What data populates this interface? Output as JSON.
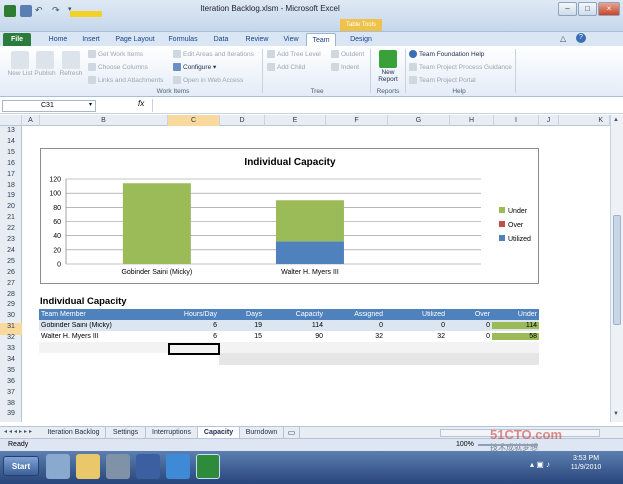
{
  "window": {
    "title": "Iteration Backlog.xlsm - Microsoft Excel",
    "context_label": "Table Tools",
    "controls": [
      "–",
      "□",
      "×"
    ]
  },
  "tabs": [
    "File",
    "Home",
    "Insert",
    "Page Layout",
    "Formulas",
    "Data",
    "Review",
    "View",
    "Team",
    "Design"
  ],
  "active_tab": "Team",
  "ribbon": {
    "new_list": "New List",
    "publish": "Publish",
    "refresh": "Refresh",
    "get_work_items": "Get Work Items",
    "choose_columns": "Choose Columns",
    "links_attachments": "Links and Attachments",
    "edit_areas": "Edit Areas and Iterations",
    "configure": "Configure ▾",
    "open_web_access": "Open in Web Access",
    "group_work_items": "Work Items",
    "add_tree_level": "Add Tree Level",
    "add_child": "Add Child",
    "outdent": "Outdent",
    "indent": "Indent",
    "group_tree": "Tree",
    "new_report": "New Report",
    "group_reports": "Reports",
    "tf_help": "Team Foundation Help",
    "tp_guidance": "Team Project Process Guidance",
    "tp_portal": "Team Project Portal",
    "group_help": "Help"
  },
  "formula_bar": {
    "name_box": "C31",
    "fx": "fx",
    "value": ""
  },
  "columns": [
    "A",
    "B",
    "C",
    "D",
    "E",
    "F",
    "G",
    "H",
    "I",
    "J",
    "K"
  ],
  "rows": [
    "13",
    "14",
    "15",
    "16",
    "17",
    "18",
    "19",
    "20",
    "21",
    "22",
    "23",
    "24",
    "25",
    "26",
    "27",
    "28",
    "29",
    "30",
    "31",
    "32",
    "33",
    "34",
    "35",
    "36",
    "37",
    "38",
    "39"
  ],
  "chart_data": {
    "type": "bar",
    "title": "Individual Capacity",
    "categories": [
      "Gobinder Saini (Micky)",
      "Walter H. Myers III"
    ],
    "series": [
      {
        "name": "Utilized",
        "values": [
          0,
          32
        ],
        "color": "#4f81bd"
      },
      {
        "name": "Over",
        "values": [
          0,
          0
        ],
        "color": "#c0504d"
      },
      {
        "name": "Under",
        "values": [
          114,
          58
        ],
        "color": "#9bbb59"
      }
    ],
    "ylim": [
      0,
      120
    ],
    "yticks": [
      "0",
      "20",
      "40",
      "60",
      "80",
      "100",
      "120"
    ],
    "legend": [
      "Under",
      "Over",
      "Utilized"
    ],
    "legend_position": "right"
  },
  "table": {
    "title": "Individual Capacity",
    "headers": [
      "Team Member",
      "Hours/Day",
      "Days",
      "Capacity",
      "Assigned",
      "Utilized",
      "Over",
      "Under"
    ],
    "rows": [
      [
        "Gobinder Saini (Micky)",
        "6",
        "19",
        "114",
        "0",
        "0",
        "0",
        "114"
      ],
      [
        "Walter H. Myers III",
        "6",
        "15",
        "90",
        "32",
        "32",
        "0",
        "58"
      ]
    ]
  },
  "sheet_tabs": [
    "Iteration Backlog",
    "Settings",
    "Interruptions",
    "Capacity",
    "Burndown"
  ],
  "active_sheet": "Capacity",
  "status": {
    "ready": "Ready",
    "zoom": "100%"
  },
  "taskbar": {
    "start": "Start",
    "time": "3:53 PM",
    "date": "11/9/2010"
  },
  "watermark": {
    "site": "51CTO.com",
    "sub": "技术成就梦想"
  },
  "colors": {
    "accent": "#4f81bd",
    "under": "#9bbb59",
    "over": "#c0504d",
    "file_tab": "#2a7b3d"
  }
}
